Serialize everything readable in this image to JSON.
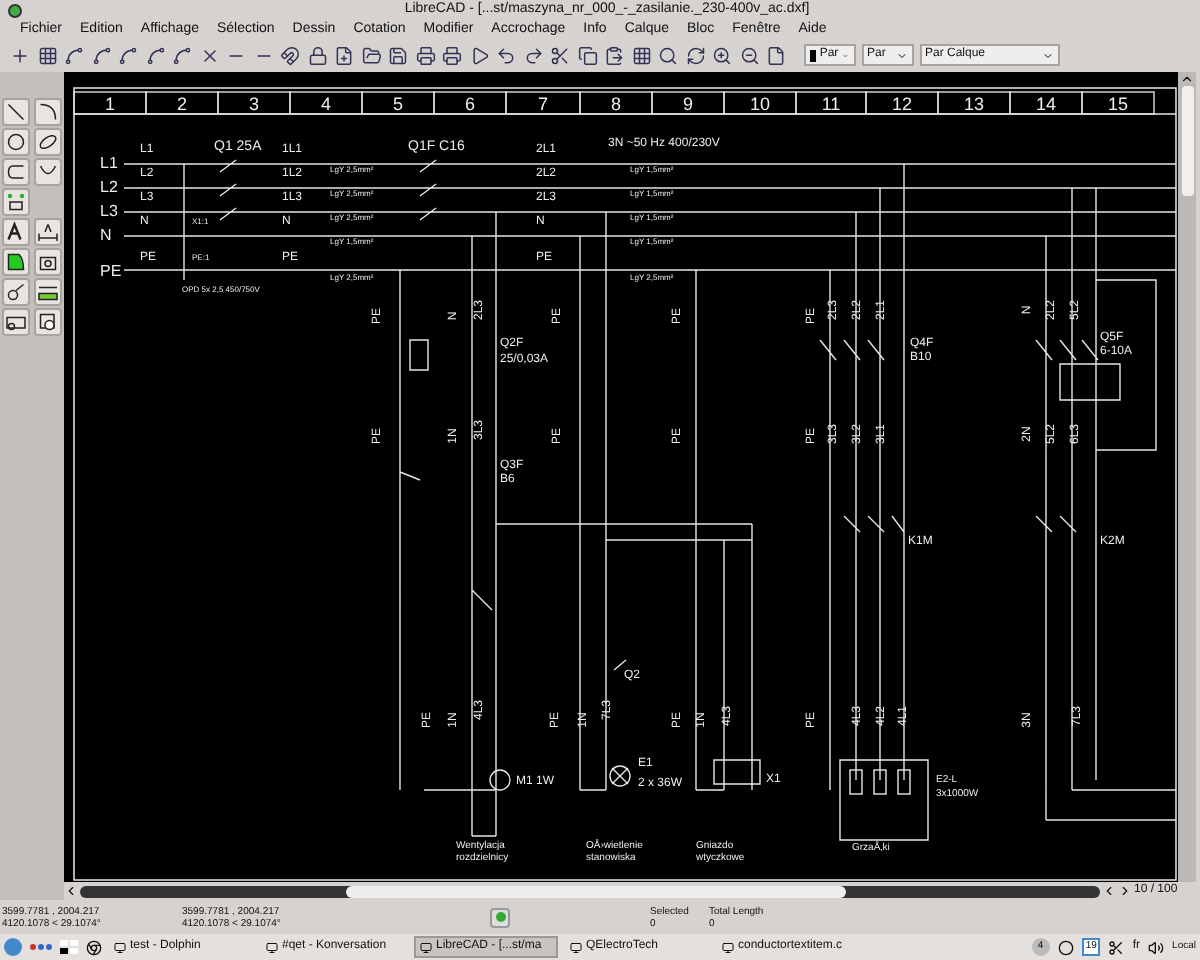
{
  "window": {
    "title": "LibreCAD - [...st/maszyna_nr_000_-_zasilanie._230-400v_ac.dxf]"
  },
  "menu": [
    "Fichier",
    "Edition",
    "Affichage",
    "Sélection",
    "Dessin",
    "Cotation",
    "Modifier",
    "Accrochage",
    "Info",
    "Calque",
    "Bloc",
    "Fenêtre",
    "Aide"
  ],
  "toolbar": {
    "combos": [
      {
        "value": "Par"
      },
      {
        "value": "Par"
      },
      {
        "value": "Par Calque"
      }
    ]
  },
  "drawing": {
    "columns": [
      "1",
      "2",
      "3",
      "4",
      "5",
      "6",
      "7",
      "8",
      "9",
      "10",
      "11",
      "12",
      "13",
      "14",
      "15"
    ],
    "labels": [
      "L1",
      "L2",
      "L3",
      "N",
      "PE",
      "L1",
      "L2",
      "L3",
      "N",
      "PE",
      "Q1 25A",
      "1L1",
      "1L2",
      "1L3",
      "N",
      "PE",
      "Q1F C16",
      "2L1",
      "2L2",
      "2L3",
      "N",
      "PE",
      "X1:1",
      "PE:1",
      "OPD 5x 2,5 450/750V",
      "3N ~50 Hz 400/230V",
      "LgY 2,5mm²",
      "LgY 2,5mm²",
      "LgY 2,5mm²",
      "LgY 1,5mm²",
      "LgY 2,5mm²",
      "LgY 1,5mm²",
      "LgY 1,5mm²",
      "LgY 1,5mm²",
      "LgY 1,5mm²",
      "LgY 2,5mm²",
      "Q2F",
      "25/0,03A",
      "Q3F",
      "B6",
      "Q4F",
      "B10",
      "Q5F",
      "6-10A",
      "K1M",
      "K2M",
      "Q2",
      "M1 1W",
      "E1",
      "2 x 36W",
      "X1",
      "E2-L",
      "3x1000W",
      "Wentylacja",
      "rozdzielnicy",
      "OÅ›wietlenie",
      "stanowiska",
      "Gniazdo",
      "wtyczkowe",
      "GrzaÅ‚ki"
    ],
    "vertical_labels": [
      "PE",
      "N",
      "2L3",
      "PE",
      "PE",
      "1N",
      "3L3",
      "PE",
      "PE",
      "PE",
      "2L3",
      "2L2",
      "2L1",
      "N",
      "2L2",
      "5L2",
      "PE",
      "PE",
      "3L3",
      "3L2",
      "3L1",
      "2N",
      "5L2",
      "6L3",
      "PE",
      "1N",
      "4L3",
      "PE",
      "1N",
      "7L3",
      "PE",
      "1N",
      "4L3",
      "PE",
      "4L3",
      "4L2",
      "4L1",
      "3N",
      "7L3"
    ]
  },
  "horizontal_scroll": {
    "page": "10 / 100"
  },
  "status_bar": {
    "coordinates": [
      {
        "absolute": "3599.7781 , 2004.217",
        "polar": "4120.1078 < 29.1074°"
      },
      {
        "absolute": "3599.7781 , 2004.217",
        "polar": "4120.1078 < 29.1074°"
      }
    ],
    "selected_label": "Selected",
    "selected_value": "0",
    "length_label": "Total Length",
    "length_value": "0"
  },
  "taskbar": {
    "tasks": [
      {
        "label": "test - Dolphin",
        "selected": false
      },
      {
        "label": "#qet - Konversation",
        "selected": false
      },
      {
        "label": "LibreCAD - [...st/ma",
        "selected": true
      },
      {
        "label": "QElectroTech",
        "selected": false
      },
      {
        "label": "conductortextitem.c",
        "selected": false
      }
    ],
    "badge": "4",
    "date": "19",
    "language": "fr",
    "clock_label": "Local"
  }
}
